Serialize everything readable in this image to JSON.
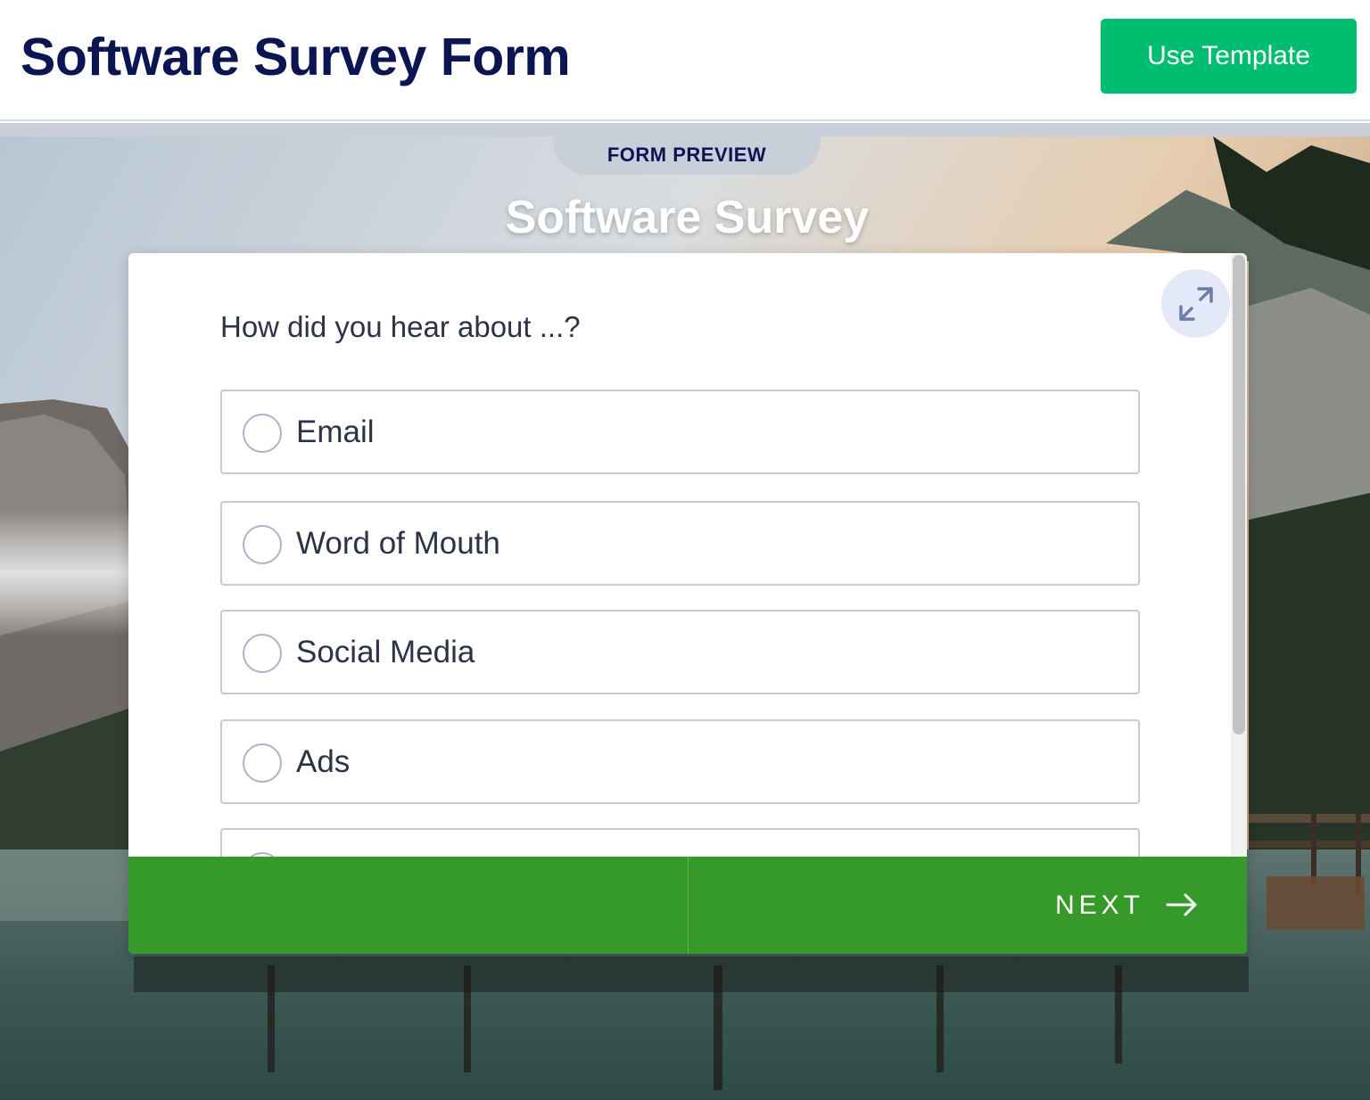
{
  "header": {
    "title": "Software Survey Form",
    "use_template_label": "Use Template"
  },
  "preview": {
    "tab_label": "FORM PREVIEW",
    "survey_title": "Software Survey"
  },
  "form": {
    "question": "How did you hear about ...?",
    "options": [
      {
        "label": "Email"
      },
      {
        "label": "Word of Mouth"
      },
      {
        "label": "Social Media"
      },
      {
        "label": "Ads"
      },
      {
        "label": ""
      }
    ],
    "next_label": "NEXT"
  },
  "colors": {
    "brand_navy": "#0a1551",
    "use_template_green": "#01bd6f",
    "footer_green": "#369a2a",
    "expand_button_bg": "#e3e9f8"
  },
  "icons": {
    "expand": "expand-arrows-icon",
    "next": "arrow-right-icon",
    "radio": "radio-circle-icon"
  }
}
